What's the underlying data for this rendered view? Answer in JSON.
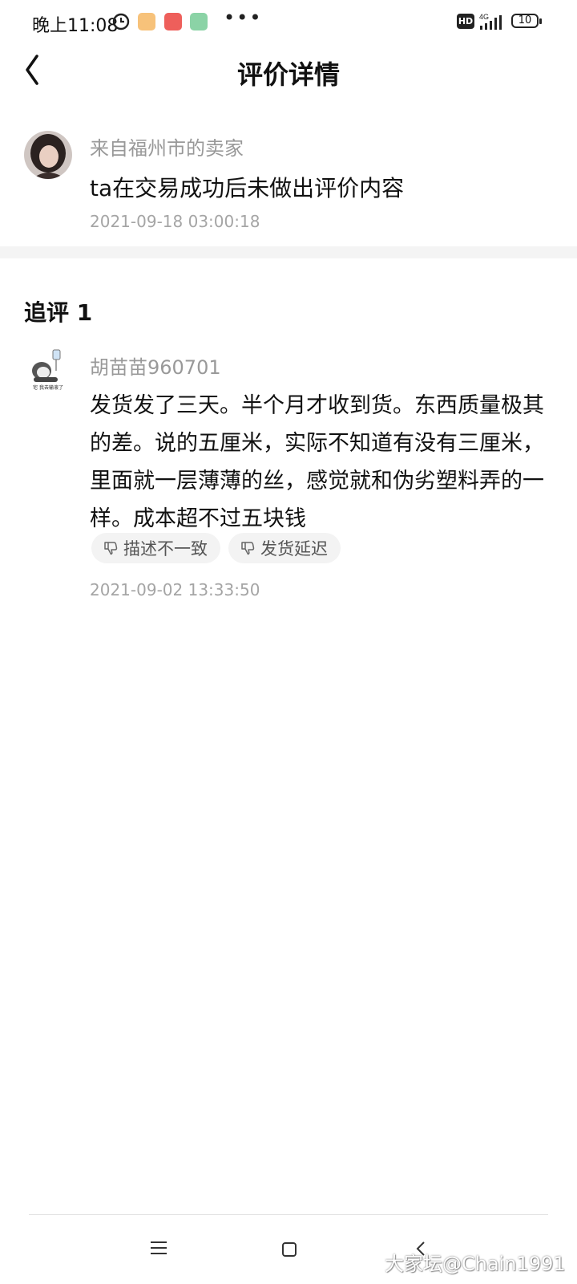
{
  "status_bar": {
    "time": "晚上11:08",
    "network": "4G",
    "hd": "HD",
    "battery": "10"
  },
  "header": {
    "title": "评价详情"
  },
  "seller_review": {
    "from": "来自福州市的卖家",
    "comment": "ta在交易成功后未做出评价内容",
    "time": "2021-09-18 03:00:18"
  },
  "followup": {
    "heading": "追评 1",
    "reviewer": "胡苗苗960701",
    "avatar_caption": "宅 我去输液了",
    "body": "发货发了三天。半个月才收到货。东西质量极其的差。说的五厘米，实际不知道有没有三厘米，里面就一层薄薄的丝，感觉就和伪劣塑料弄的一样。成本超不过五块钱",
    "tags": [
      "描述不一致",
      "发货延迟"
    ],
    "time": "2021-09-02 13:33:50"
  },
  "watermark": "大家坛@Chain1991",
  "icons": {
    "back": "chevron-left-icon",
    "tag": "thumbs-down-icon",
    "nav_menu": "menu-icon",
    "nav_home": "home-square-icon",
    "nav_back": "back-chevron-icon"
  }
}
